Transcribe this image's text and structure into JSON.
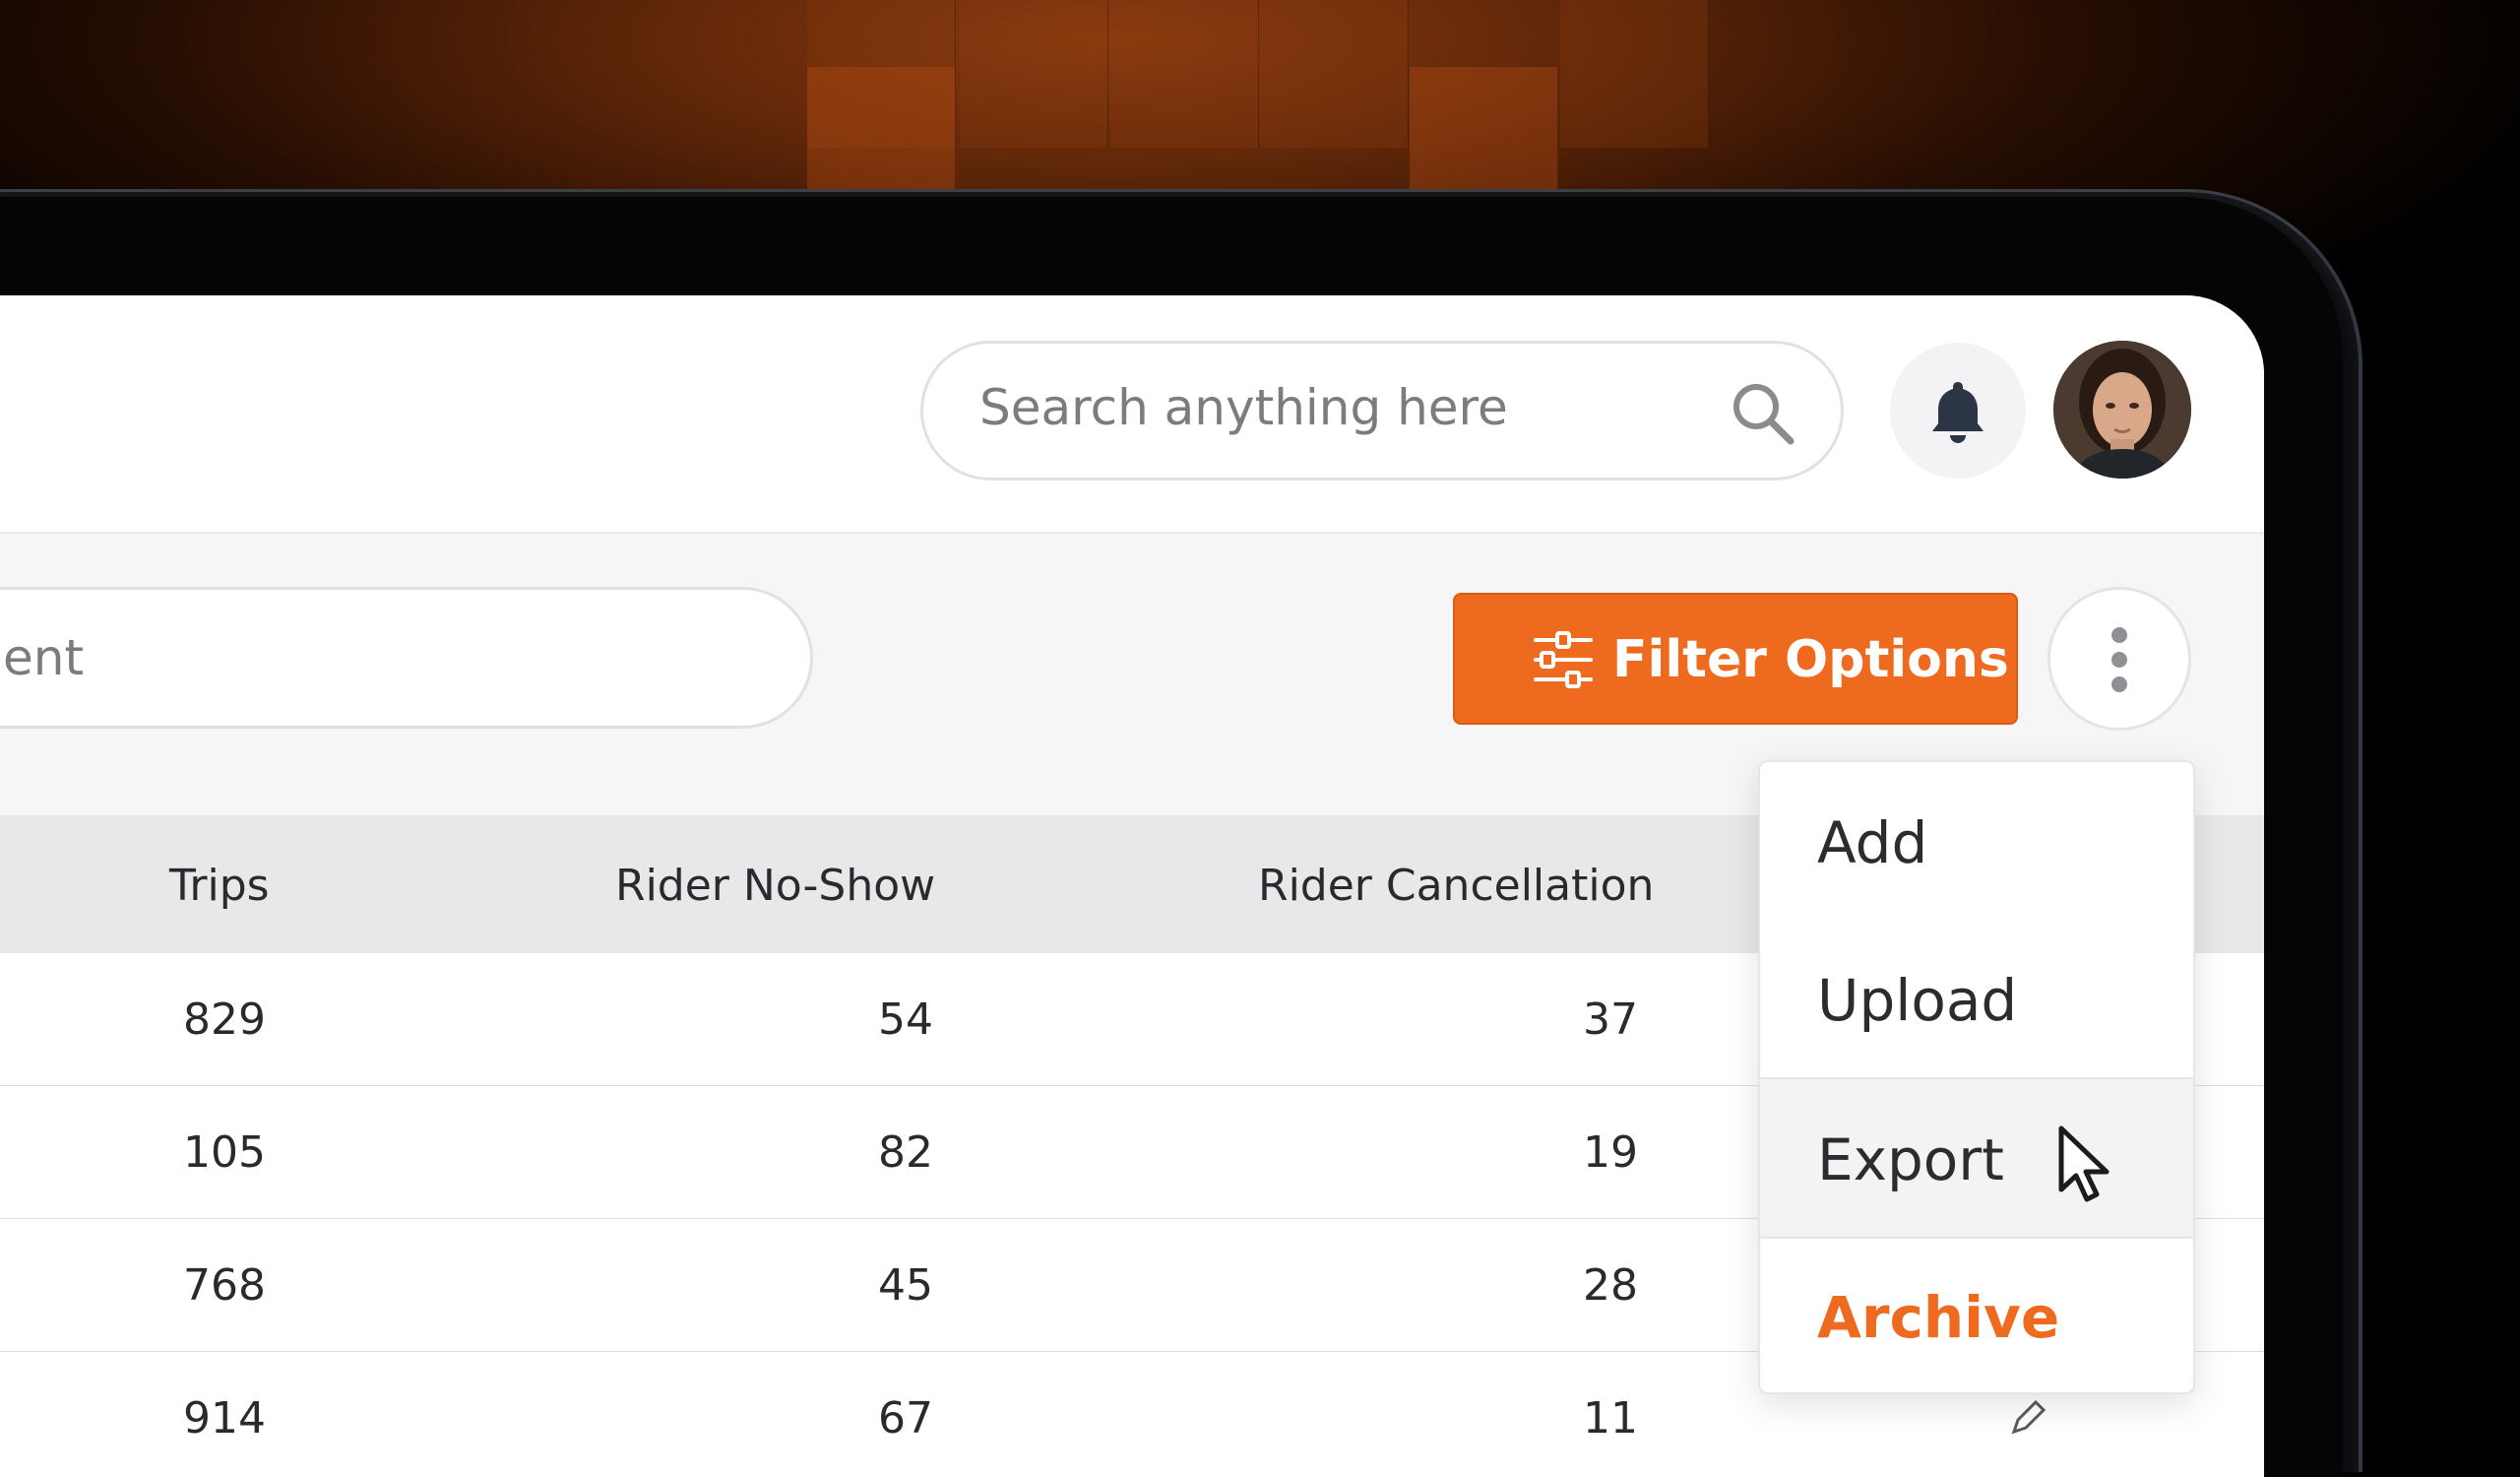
{
  "header": {
    "search_placeholder": "Search anything here",
    "icons": [
      "search-icon",
      "bell-icon",
      "avatar"
    ]
  },
  "toolbar": {
    "search_partial_text": "ent",
    "filter_label": "Filter Options",
    "more_icon": "vertical-dots-icon"
  },
  "table": {
    "columns": [
      "Trips",
      "Rider No-Show",
      "Rider Cancellation"
    ],
    "rows": [
      [
        "829",
        "54",
        "37"
      ],
      [
        "105",
        "82",
        "19"
      ],
      [
        "768",
        "45",
        "28"
      ],
      [
        "914",
        "67",
        "11"
      ]
    ]
  },
  "menu": {
    "items": [
      {
        "label": "Add"
      },
      {
        "label": "Upload"
      },
      {
        "label": "Export"
      },
      {
        "label": "Archive"
      }
    ],
    "hovered_item": "Export"
  },
  "colors": {
    "accent": "#ee6a1f",
    "background": "#000000",
    "panel": "#ffffff",
    "table_header": "#e8e8ea"
  }
}
